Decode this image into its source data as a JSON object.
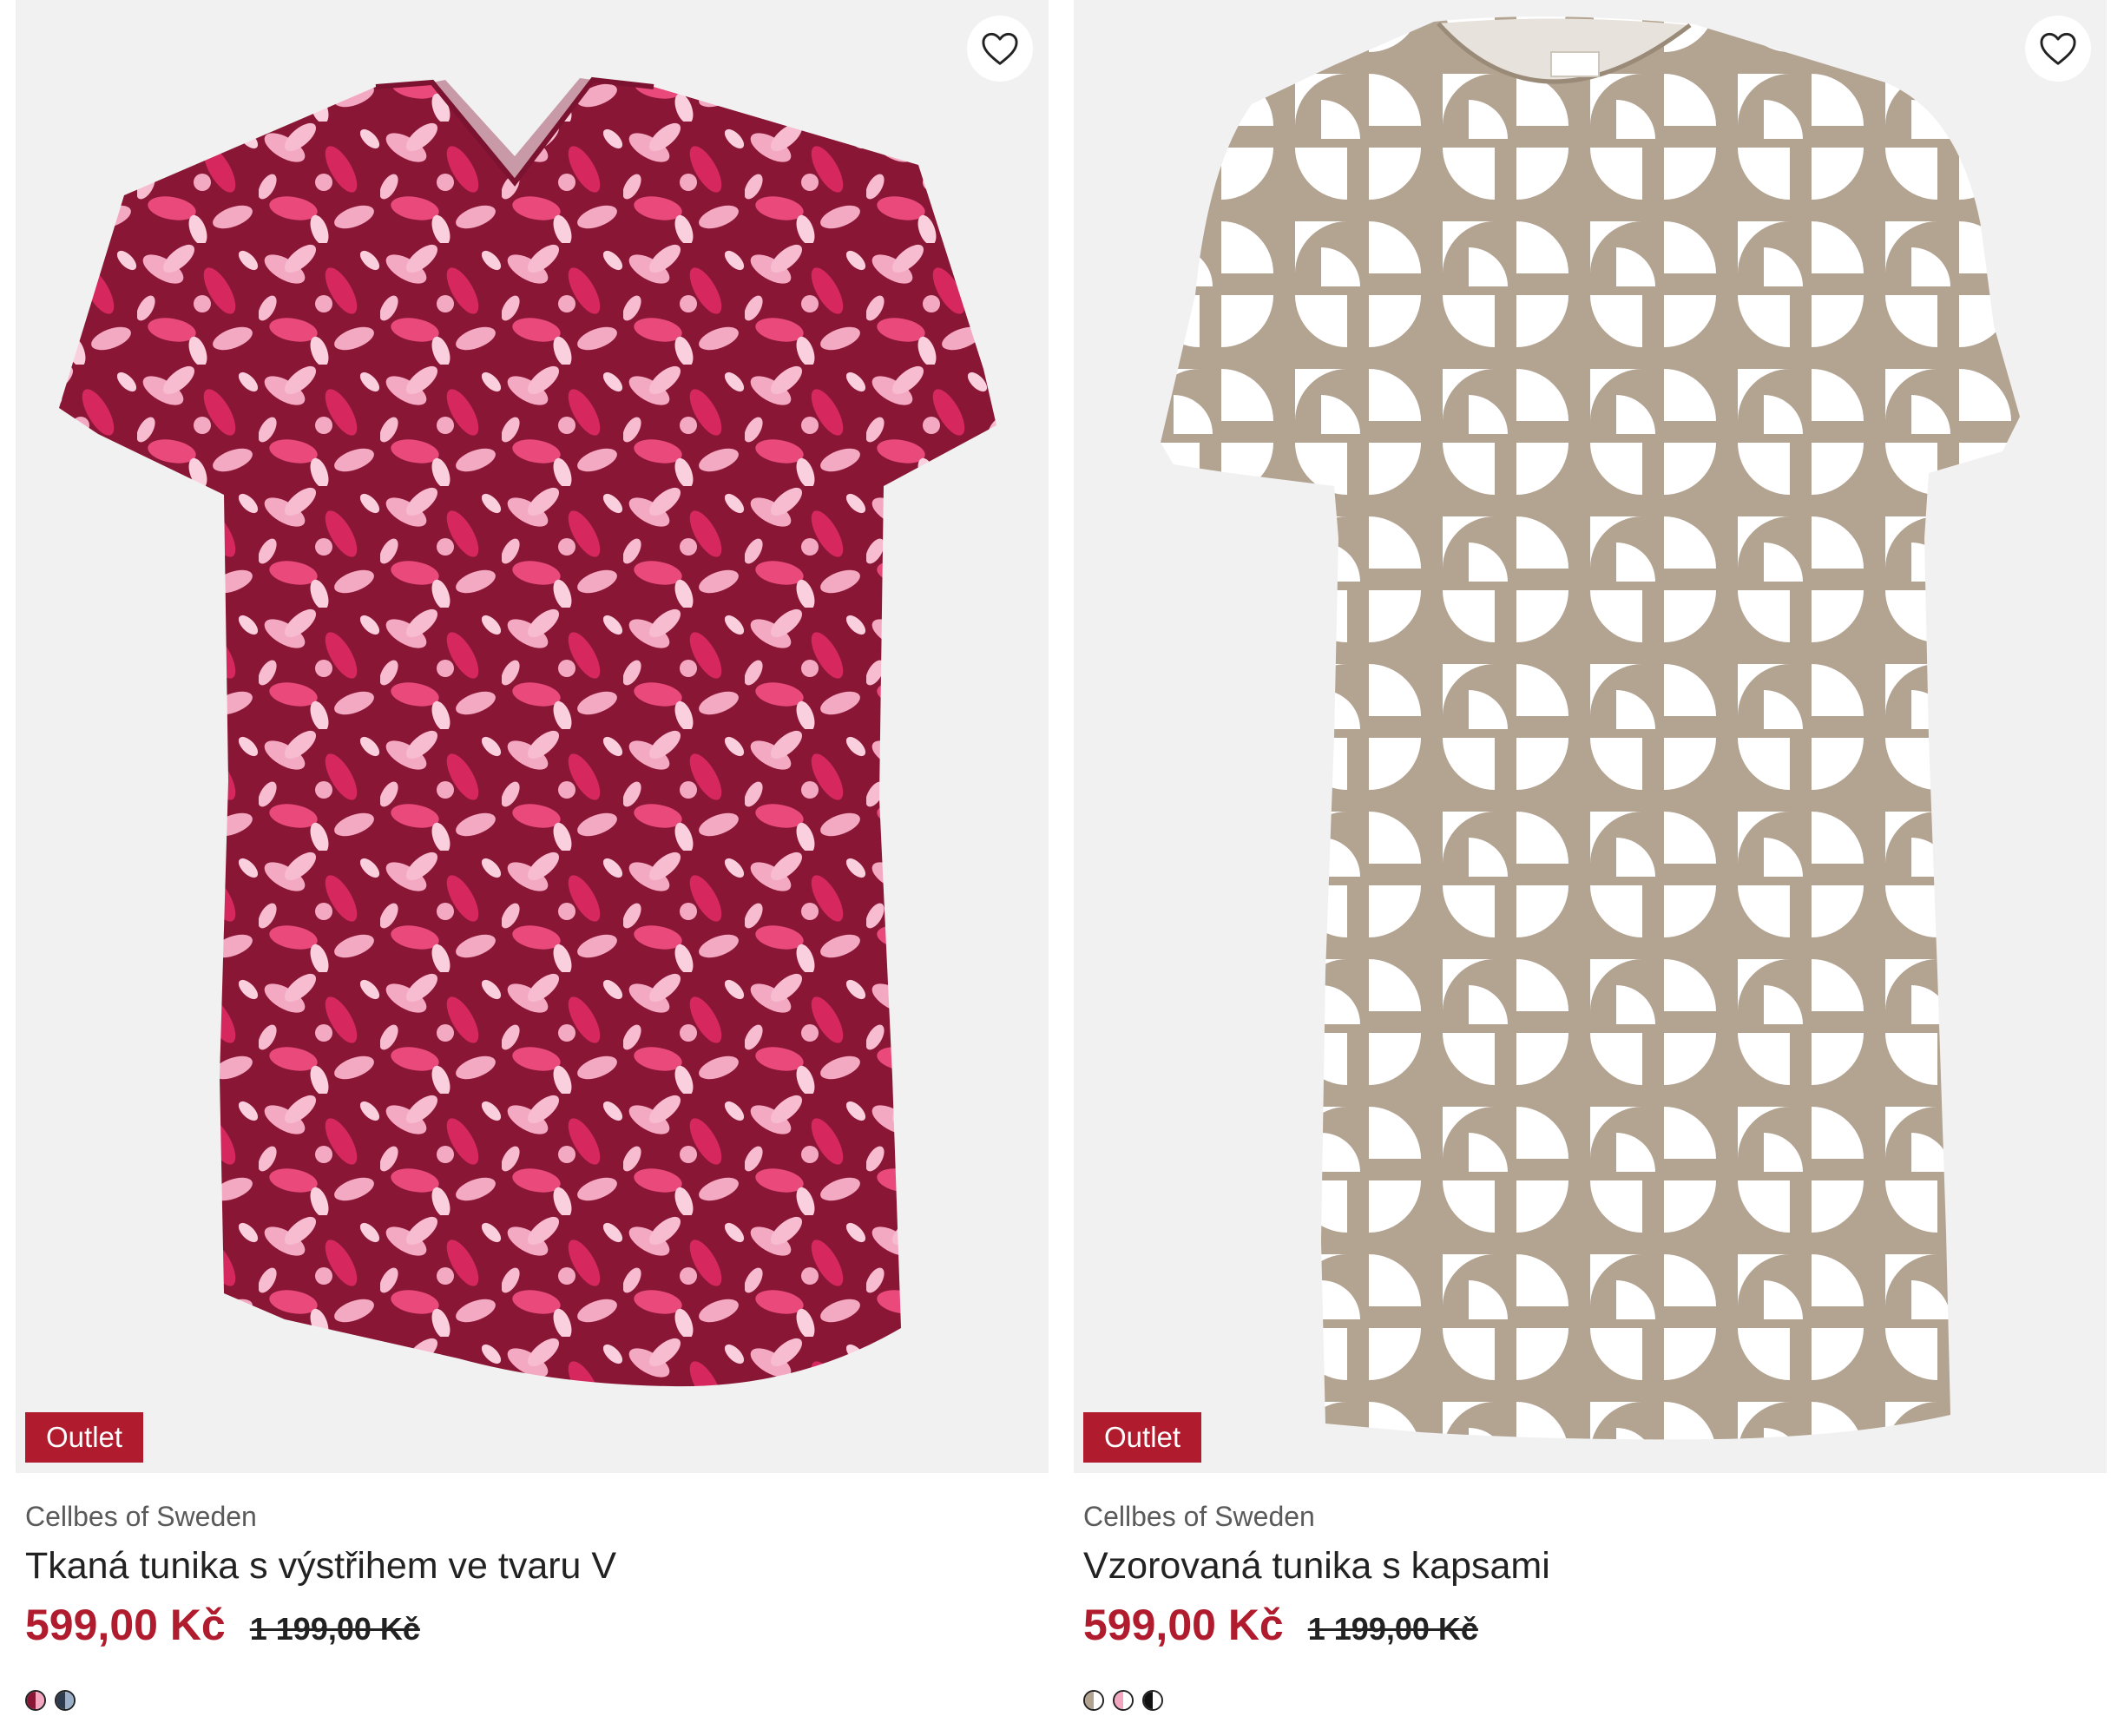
{
  "colors": {
    "accent": "#b01c2e",
    "badge_bg": "#b01c2e",
    "image_bg": "#f1f1f1"
  },
  "products": [
    {
      "badge": "Outlet",
      "brand": "Cellbes of Sweden",
      "name": "Tkaná tunika s výstřihem ve tvaru V",
      "price": "599,00 Kč",
      "old_price": "1 199,00 Kč",
      "favorite_icon": "heart-outline-icon",
      "swatches": [
        {
          "left": "#8a1636",
          "right": "#f2a6c0"
        },
        {
          "left": "#2e3a4e",
          "right": "#9bb0c8"
        }
      ]
    },
    {
      "badge": "Outlet",
      "brand": "Cellbes of Sweden",
      "name": "Vzorovaná tunika s kapsami",
      "price": "599,00 Kč",
      "old_price": "1 199,00 Kč",
      "favorite_icon": "heart-outline-icon",
      "swatches": [
        {
          "left": "#b3a391",
          "right": "#ffffff"
        },
        {
          "left": "#f2a6c0",
          "right": "#ffffff"
        },
        {
          "left": "#111111",
          "right": "#ffffff"
        }
      ]
    }
  ]
}
